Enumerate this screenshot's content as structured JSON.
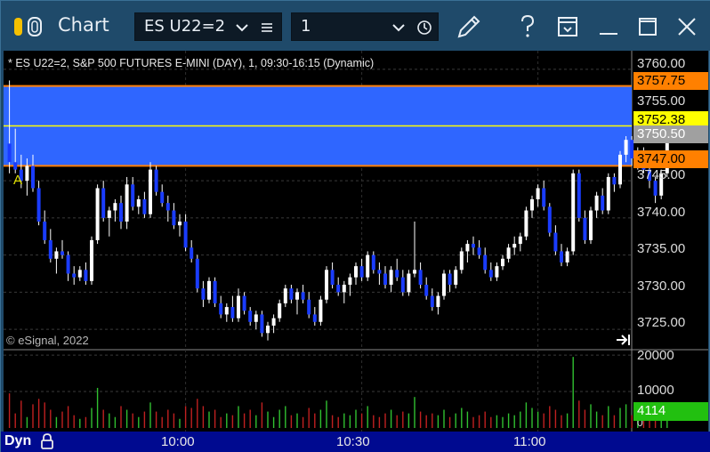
{
  "window": {
    "title": "Chart",
    "symbol": "ES U22=2",
    "interval": "1",
    "icons": [
      "app-toggle-icon",
      "chevron-down-icon",
      "menu-lines-icon",
      "clock-icon",
      "pencil-icon",
      "help-icon",
      "template-icon",
      "minimize-icon",
      "maximize-icon",
      "close-icon"
    ]
  },
  "chart_header": "* ES U22=2, S&P 500 FUTURES E-MINI (DAY), 1, 09:30-16:15 (Dynamic)",
  "copyright": "© eSignal, 2022",
  "marker_label": "A",
  "price_axis": {
    "ticks": [
      "3760.00",
      "3755.00",
      "3745.00",
      "3740.00",
      "3735.00",
      "3730.00",
      "3725.00"
    ],
    "tags": [
      {
        "label": "3757.75",
        "value": 3757.75,
        "bg": "#ff8000",
        "fg": "#000000"
      },
      {
        "label": "3752.38",
        "value": 3752.38,
        "bg": "#ffff00",
        "fg": "#000000"
      },
      {
        "label": "3750.50",
        "value": 3750.5,
        "bg": "#a0a0a0",
        "fg": "#ffffff"
      },
      {
        "label": "3747.00",
        "value": 3747.0,
        "bg": "#ff8000",
        "fg": "#000000"
      }
    ]
  },
  "volume_axis": {
    "ticks": [
      "20000",
      "10000",
      "0"
    ],
    "current_label": "4114",
    "current_value": 4114,
    "current_bg": "#22c010"
  },
  "time_axis": {
    "labels": [
      "10:00",
      "10:30",
      "11:00"
    ],
    "label_minutes": [
      30,
      60,
      90
    ]
  },
  "bottom_bar": {
    "mode": "Dyn"
  },
  "colors": {
    "zone_fill": "#2f66ff",
    "zone_border": "#ff8000",
    "mid_line": "#ffff00",
    "up_candle": "#ffffff",
    "down_candle": "#1a3cff",
    "vol_up": "#30c030",
    "vol_down": "#c02020"
  },
  "chart_data": {
    "type": "candlestick",
    "title": "* ES U22=2, S&P 500 FUTURES E-MINI (DAY), 1, 09:30-16:15 (Dynamic)",
    "interval_minutes": 1,
    "x_start": "09:30",
    "y_price_range": [
      3722.5,
      3762.5
    ],
    "y_volume_range": [
      0,
      21000
    ],
    "zone": {
      "top": 3757.75,
      "bottom": 3747.0,
      "mid": 3752.38
    },
    "ohlc": [
      [
        3750.0,
        3758.5,
        3746.0,
        3747.5
      ],
      [
        3747.5,
        3752.0,
        3746.0,
        3746.5
      ],
      [
        3746.5,
        3748.5,
        3744.0,
        3745.0
      ],
      [
        3745.0,
        3748.0,
        3743.0,
        3747.0
      ],
      [
        3747.0,
        3748.5,
        3743.5,
        3744.0
      ],
      [
        3744.0,
        3745.0,
        3739.0,
        3739.5
      ],
      [
        3739.5,
        3741.0,
        3736.5,
        3737.0
      ],
      [
        3737.0,
        3738.5,
        3734.0,
        3734.5
      ],
      [
        3734.5,
        3736.0,
        3732.5,
        3735.5
      ],
      [
        3735.5,
        3737.0,
        3734.5,
        3735.0
      ],
      [
        3735.0,
        3735.5,
        3731.5,
        3732.5
      ],
      [
        3732.5,
        3733.5,
        3731.0,
        3732.0
      ],
      [
        3732.0,
        3733.5,
        3731.5,
        3733.0
      ],
      [
        3733.0,
        3734.0,
        3731.0,
        3731.5
      ],
      [
        3731.5,
        3737.5,
        3731.0,
        3737.0
      ],
      [
        3737.0,
        3744.5,
        3736.5,
        3744.0
      ],
      [
        3744.0,
        3745.0,
        3739.5,
        3740.0
      ],
      [
        3740.0,
        3741.5,
        3737.5,
        3741.0
      ],
      [
        3741.0,
        3742.5,
        3739.5,
        3742.0
      ],
      [
        3742.0,
        3743.0,
        3738.5,
        3739.5
      ],
      [
        3739.5,
        3745.5,
        3738.5,
        3744.5
      ],
      [
        3744.5,
        3745.5,
        3741.0,
        3741.5
      ],
      [
        3741.5,
        3743.0,
        3740.5,
        3742.5
      ],
      [
        3742.5,
        3743.5,
        3740.0,
        3740.5
      ],
      [
        3740.5,
        3747.5,
        3740.0,
        3746.5
      ],
      [
        3746.5,
        3747.0,
        3743.0,
        3743.5
      ],
      [
        3743.5,
        3744.5,
        3741.5,
        3742.0
      ],
      [
        3742.0,
        3743.0,
        3739.5,
        3741.0
      ],
      [
        3741.0,
        3742.0,
        3738.5,
        3739.0
      ],
      [
        3739.0,
        3740.5,
        3737.5,
        3739.5
      ],
      [
        3739.5,
        3740.5,
        3735.5,
        3736.0
      ],
      [
        3736.0,
        3737.0,
        3734.0,
        3734.5
      ],
      [
        3734.5,
        3735.0,
        3730.0,
        3730.5
      ],
      [
        3730.5,
        3731.5,
        3728.0,
        3729.0
      ],
      [
        3729.0,
        3732.0,
        3728.5,
        3731.5
      ],
      [
        3731.5,
        3732.0,
        3728.0,
        3728.5
      ],
      [
        3728.5,
        3729.5,
        3726.5,
        3727.0
      ],
      [
        3727.0,
        3728.5,
        3726.0,
        3728.0
      ],
      [
        3728.0,
        3729.5,
        3726.0,
        3726.5
      ],
      [
        3726.5,
        3730.5,
        3726.0,
        3729.5
      ],
      [
        3729.5,
        3730.0,
        3727.0,
        3727.5
      ],
      [
        3727.5,
        3728.0,
        3725.5,
        3726.0
      ],
      [
        3726.0,
        3727.5,
        3725.0,
        3727.0
      ],
      [
        3727.0,
        3727.5,
        3724.0,
        3724.5
      ],
      [
        3724.5,
        3726.0,
        3723.5,
        3725.5
      ],
      [
        3725.5,
        3727.0,
        3724.5,
        3726.5
      ],
      [
        3726.5,
        3729.0,
        3726.0,
        3728.5
      ],
      [
        3728.5,
        3731.0,
        3728.0,
        3730.5
      ],
      [
        3730.5,
        3731.0,
        3728.5,
        3729.0
      ],
      [
        3729.0,
        3730.5,
        3727.0,
        3730.0
      ],
      [
        3730.0,
        3731.0,
        3728.5,
        3729.0
      ],
      [
        3729.0,
        3730.0,
        3726.5,
        3727.0
      ],
      [
        3727.0,
        3728.0,
        3725.5,
        3726.0
      ],
      [
        3726.0,
        3729.5,
        3725.5,
        3729.0
      ],
      [
        3729.0,
        3733.5,
        3728.5,
        3733.0
      ],
      [
        3733.0,
        3734.0,
        3730.5,
        3731.0
      ],
      [
        3731.0,
        3732.0,
        3729.5,
        3730.0
      ],
      [
        3730.0,
        3731.5,
        3728.5,
        3731.0
      ],
      [
        3731.0,
        3732.5,
        3729.5,
        3732.0
      ],
      [
        3732.0,
        3734.0,
        3731.0,
        3733.5
      ],
      [
        3733.5,
        3734.5,
        3731.5,
        3732.0
      ],
      [
        3732.0,
        3735.5,
        3731.5,
        3735.0
      ],
      [
        3735.0,
        3735.5,
        3732.5,
        3733.0
      ],
      [
        3733.0,
        3734.0,
        3731.0,
        3732.5
      ],
      [
        3732.5,
        3733.5,
        3730.5,
        3731.0
      ],
      [
        3731.0,
        3733.5,
        3730.0,
        3733.0
      ],
      [
        3733.0,
        3734.5,
        3731.5,
        3732.0
      ],
      [
        3732.0,
        3733.0,
        3729.5,
        3730.0
      ],
      [
        3730.0,
        3733.0,
        3729.5,
        3732.5
      ],
      [
        3732.5,
        3739.5,
        3732.0,
        3733.0
      ],
      [
        3733.0,
        3734.0,
        3730.5,
        3731.0
      ],
      [
        3731.0,
        3732.0,
        3729.0,
        3729.5
      ],
      [
        3729.5,
        3730.5,
        3727.5,
        3728.0
      ],
      [
        3728.0,
        3730.0,
        3727.0,
        3729.5
      ],
      [
        3729.5,
        3733.0,
        3729.0,
        3732.5
      ],
      [
        3732.5,
        3733.0,
        3730.0,
        3731.0
      ],
      [
        3731.0,
        3733.5,
        3730.5,
        3733.0
      ],
      [
        3733.0,
        3736.0,
        3732.5,
        3735.5
      ],
      [
        3735.5,
        3737.0,
        3734.0,
        3736.5
      ],
      [
        3736.5,
        3737.5,
        3735.0,
        3736.0
      ],
      [
        3736.0,
        3737.0,
        3734.5,
        3735.0
      ],
      [
        3735.0,
        3736.0,
        3732.5,
        3733.0
      ],
      [
        3733.0,
        3734.0,
        3731.5,
        3732.0
      ],
      [
        3732.0,
        3734.0,
        3731.5,
        3733.5
      ],
      [
        3733.5,
        3735.0,
        3733.0,
        3734.5
      ],
      [
        3734.5,
        3736.5,
        3734.0,
        3736.0
      ],
      [
        3736.0,
        3737.5,
        3735.0,
        3736.5
      ],
      [
        3736.5,
        3738.0,
        3735.5,
        3737.5
      ],
      [
        3737.5,
        3741.5,
        3737.0,
        3741.0
      ],
      [
        3741.0,
        3743.0,
        3740.0,
        3742.5
      ],
      [
        3742.5,
        3744.5,
        3741.5,
        3744.0
      ],
      [
        3744.0,
        3745.0,
        3741.0,
        3741.5
      ],
      [
        3741.5,
        3742.0,
        3737.5,
        3738.0
      ],
      [
        3738.0,
        3739.0,
        3735.0,
        3735.5
      ],
      [
        3735.5,
        3736.5,
        3733.5,
        3734.0
      ],
      [
        3734.0,
        3736.0,
        3733.5,
        3735.5
      ],
      [
        3735.5,
        3746.5,
        3735.0,
        3746.0
      ],
      [
        3746.0,
        3746.5,
        3739.5,
        3740.0
      ],
      [
        3740.0,
        3741.0,
        3736.5,
        3737.0
      ],
      [
        3737.0,
        3741.5,
        3736.5,
        3741.0
      ],
      [
        3741.0,
        3743.5,
        3740.0,
        3743.0
      ],
      [
        3743.0,
        3744.0,
        3740.5,
        3741.0
      ],
      [
        3741.0,
        3746.0,
        3740.5,
        3745.5
      ],
      [
        3745.5,
        3746.0,
        3743.5,
        3744.5
      ],
      [
        3744.5,
        3749.0,
        3744.0,
        3748.5
      ],
      [
        3748.5,
        3751.0,
        3747.5,
        3750.5
      ],
      [
        3750.5,
        3751.0,
        3747.0,
        3748.0
      ],
      [
        3748.0,
        3749.5,
        3746.5,
        3749.0
      ],
      [
        3749.0,
        3749.5,
        3746.0,
        3746.5
      ],
      [
        3746.5,
        3747.0,
        3744.0,
        3745.0
      ],
      [
        3745.0,
        3745.5,
        3742.0,
        3743.0
      ],
      [
        3743.0,
        3746.5,
        3742.5,
        3746.0
      ],
      [
        3746.0,
        3751.0,
        3745.5,
        3750.5
      ]
    ],
    "volume": [
      9500,
      4000,
      7500,
      3000,
      6500,
      8000,
      7000,
      5000,
      3000,
      4500,
      6000,
      3500,
      2500,
      3000,
      5500,
      11000,
      5000,
      4000,
      3000,
      6000,
      5000,
      4000,
      3000,
      4500,
      7000,
      4500,
      3000,
      5000,
      4000,
      2500,
      6000,
      5500,
      8000,
      6000,
      4500,
      5000,
      3000,
      4000,
      3500,
      6000,
      4000,
      5000,
      3500,
      7000,
      4500,
      3000,
      5000,
      6000,
      3500,
      4000,
      3000,
      5500,
      4000,
      5000,
      7500,
      3500,
      3000,
      4000,
      3500,
      5000,
      4000,
      6000,
      3500,
      3000,
      4000,
      5000,
      3500,
      4500,
      4000,
      8500,
      4500,
      3500,
      4000,
      3500,
      5000,
      3000,
      4000,
      5500,
      4500,
      3000,
      3500,
      4500,
      3000,
      3500,
      3000,
      4000,
      3500,
      4500,
      7000,
      5500,
      4500,
      4000,
      6000,
      5000,
      3500,
      4000,
      19500,
      7500,
      5000,
      6500,
      4500,
      3500,
      6000,
      3500,
      5500,
      6500,
      3500,
      2500,
      4000,
      3000,
      4000,
      3500,
      4114
    ]
  }
}
